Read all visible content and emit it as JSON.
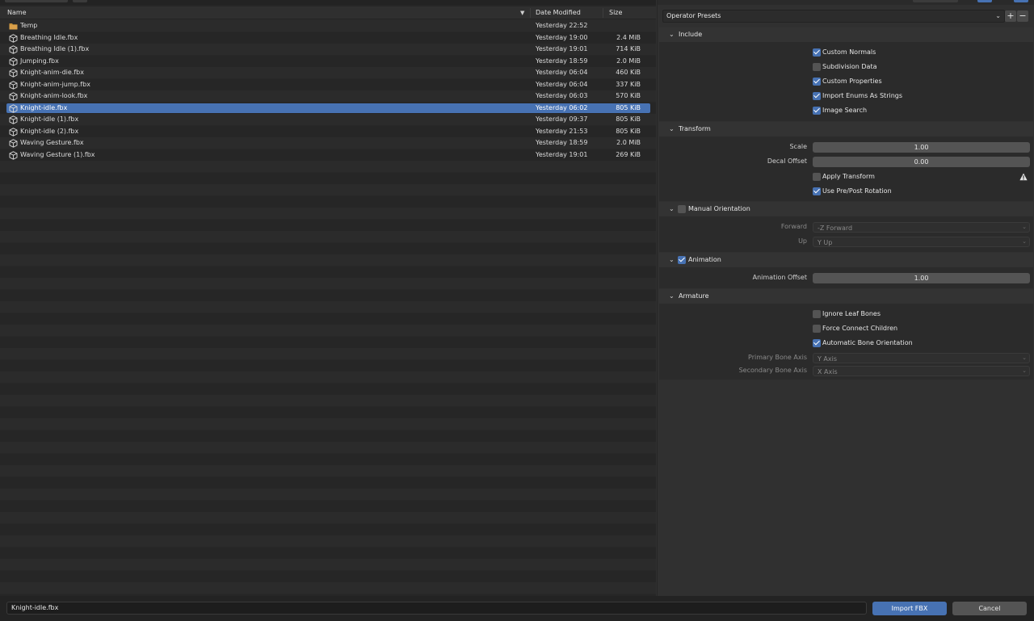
{
  "columns": {
    "name": "Name",
    "date": "Date Modified",
    "size": "Size",
    "sort_indicator": "▼"
  },
  "files": [
    {
      "name": "Temp",
      "date": "Yesterday 22:52",
      "size": "",
      "type": "folder",
      "selected": false
    },
    {
      "name": "Breathing Idle.fbx",
      "date": "Yesterday 19:00",
      "size": "2.4 MiB",
      "type": "file",
      "selected": false
    },
    {
      "name": "Breathing Idle (1).fbx",
      "date": "Yesterday 19:01",
      "size": "714 KiB",
      "type": "file",
      "selected": false
    },
    {
      "name": "Jumping.fbx",
      "date": "Yesterday 18:59",
      "size": "2.0 MiB",
      "type": "file",
      "selected": false
    },
    {
      "name": "Knight-anim-die.fbx",
      "date": "Yesterday 06:04",
      "size": "460 KiB",
      "type": "file",
      "selected": false
    },
    {
      "name": "Knight-anim-jump.fbx",
      "date": "Yesterday 06:04",
      "size": "337 KiB",
      "type": "file",
      "selected": false
    },
    {
      "name": "Knight-anim-look.fbx",
      "date": "Yesterday 06:03",
      "size": "570 KiB",
      "type": "file",
      "selected": false
    },
    {
      "name": "Knight-idle.fbx",
      "date": "Yesterday 06:02",
      "size": "805 KiB",
      "type": "file",
      "selected": true
    },
    {
      "name": "Knight-idle (1).fbx",
      "date": "Yesterday 09:37",
      "size": "805 KiB",
      "type": "file",
      "selected": false
    },
    {
      "name": "Knight-idle (2).fbx",
      "date": "Yesterday 21:53",
      "size": "805 KiB",
      "type": "file",
      "selected": false
    },
    {
      "name": "Waving Gesture.fbx",
      "date": "Yesterday 18:59",
      "size": "2.0 MiB",
      "type": "file",
      "selected": false
    },
    {
      "name": "Waving Gesture (1).fbx",
      "date": "Yesterday 19:01",
      "size": "269 KiB",
      "type": "file",
      "selected": false
    }
  ],
  "presets": {
    "label": "Operator Presets",
    "add": "+",
    "remove": "−"
  },
  "include": {
    "title": "Include",
    "options": [
      {
        "label": "Custom Normals",
        "checked": true
      },
      {
        "label": "Subdivision Data",
        "checked": false
      },
      {
        "label": "Custom Properties",
        "checked": true
      },
      {
        "label": "Import Enums As Strings",
        "checked": true
      },
      {
        "label": "Image Search",
        "checked": true
      }
    ]
  },
  "transform": {
    "title": "Transform",
    "scale_label": "Scale",
    "scale_value": "1.00",
    "decal_label": "Decal Offset",
    "decal_value": "0.00",
    "apply_transform": {
      "label": "Apply Transform",
      "checked": false
    },
    "pre_post_rotation": {
      "label": "Use Pre/Post Rotation",
      "checked": true
    }
  },
  "manual_orientation": {
    "title": "Manual Orientation",
    "checked": false,
    "forward_label": "Forward",
    "forward_value": "-Z Forward",
    "up_label": "Up",
    "up_value": "Y Up"
  },
  "animation": {
    "title": "Animation",
    "checked": true,
    "offset_label": "Animation Offset",
    "offset_value": "1.00"
  },
  "armature": {
    "title": "Armature",
    "options": [
      {
        "label": "Ignore Leaf Bones",
        "checked": false
      },
      {
        "label": "Force Connect Children",
        "checked": false
      },
      {
        "label": "Automatic Bone Orientation",
        "checked": true
      }
    ],
    "primary_label": "Primary Bone Axis",
    "primary_value": "Y Axis",
    "secondary_label": "Secondary Bone Axis",
    "secondary_value": "X Axis"
  },
  "footer": {
    "filename": "Knight-idle.fbx",
    "import_label": "Import FBX",
    "cancel_label": "Cancel"
  },
  "colors": {
    "accent": "#4772b3",
    "folder": "#c8913b"
  }
}
